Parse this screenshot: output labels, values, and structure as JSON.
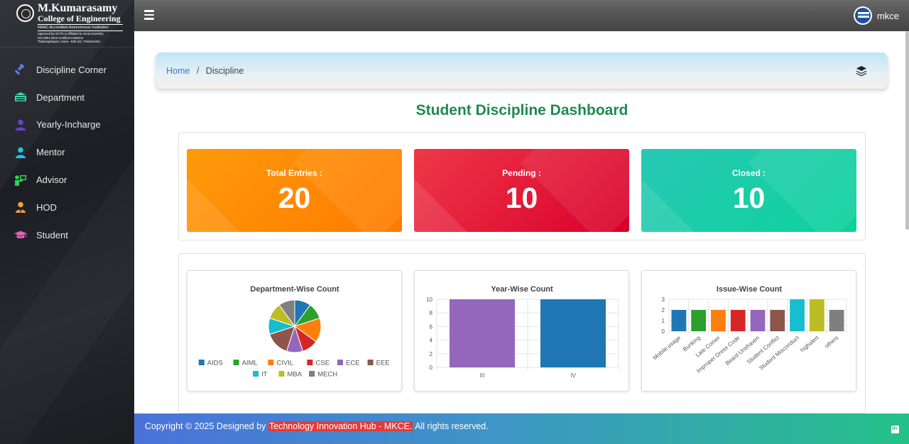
{
  "logo": {
    "name": "M.Kumarasamy",
    "college": "College of Engineering",
    "naac": "NAAC Accredited Autonomous Institution",
    "approval": "Approved by AICTE & Affiliated to Anna University",
    "iso": "ISO 9001:2015 Certified Institution",
    "address": "Thalavapalayam, Karur - 639 113, TAMILNADU."
  },
  "sidebar": {
    "items": [
      {
        "label": "Discipline Corner",
        "icon": "gavel-icon",
        "color": "#5b7ce6"
      },
      {
        "label": "Department",
        "icon": "building-icon",
        "color": "#3fd3a8"
      },
      {
        "label": "Yearly-Incharge",
        "icon": "user-icon",
        "color": "#6a3fd6"
      },
      {
        "label": "Mentor",
        "icon": "user-icon",
        "color": "#22c2e8"
      },
      {
        "label": "Advisor",
        "icon": "chalkboard-teacher-icon",
        "color": "#2ed158"
      },
      {
        "label": "HOD",
        "icon": "user-tie-icon",
        "color": "#f0a23a"
      },
      {
        "label": "Student",
        "icon": "graduation-cap-icon",
        "color": "#e85fb6"
      }
    ]
  },
  "header": {
    "user_name": "mkce"
  },
  "breadcrumb": {
    "home": "Home",
    "separator": "/",
    "current": "Discipline"
  },
  "page_title": "Student Discipline Dashboard",
  "stats": {
    "total": {
      "label": "Total Entries :",
      "value": "20"
    },
    "pending": {
      "label": "Pending :",
      "value": "10"
    },
    "closed": {
      "label": "Closed :",
      "value": "10"
    }
  },
  "chart_data": [
    {
      "type": "pie",
      "title": "Department-Wise Count",
      "labels": [
        "AIDS",
        "AIML",
        "CIVIL",
        "CSE",
        "ECE",
        "EEE",
        "IT",
        "MBA",
        "MECH"
      ],
      "values": [
        2,
        2,
        3,
        2,
        2,
        3,
        2,
        2,
        2
      ],
      "colors": [
        "#1f77b4",
        "#2ca02c",
        "#ff7f0e",
        "#d62728",
        "#9467bd",
        "#8c564b",
        "#17becf",
        "#bcbd22",
        "#7f7f7f"
      ],
      "legend": "bottom"
    },
    {
      "type": "bar",
      "title": "Year-Wise Count",
      "categories": [
        "III",
        "IV"
      ],
      "values": [
        10,
        10
      ],
      "colors": [
        "#9467bd",
        "#1f77b4"
      ],
      "ylim": [
        0,
        10
      ],
      "yticks": [
        0,
        2,
        4,
        6,
        8,
        10
      ],
      "grid": true
    },
    {
      "type": "bar",
      "title": "Issue-Wise Count",
      "categories": [
        "Mobile usage",
        "Bunking",
        "Late Comer",
        "Improper Dress Code",
        "Beard Unshaven",
        "Student Conflict",
        "Student Misconduct",
        "highalert",
        "others"
      ],
      "values": [
        2,
        2,
        2,
        2,
        2,
        2,
        3,
        3,
        2
      ],
      "colors": [
        "#1f77b4",
        "#2ca02c",
        "#ff7f0e",
        "#d62728",
        "#9467bd",
        "#8c564b",
        "#17becf",
        "#bcbd22",
        "#7f7f7f"
      ],
      "ylim": [
        0,
        3
      ],
      "yticks": [
        0,
        1,
        2,
        3
      ],
      "grid": true
    }
  ],
  "footer": {
    "prefix": "Copyright © 2025 Designed by ",
    "link": "Technology Innovation Hub - MKCE.",
    "suffix": " All rights reserved."
  }
}
